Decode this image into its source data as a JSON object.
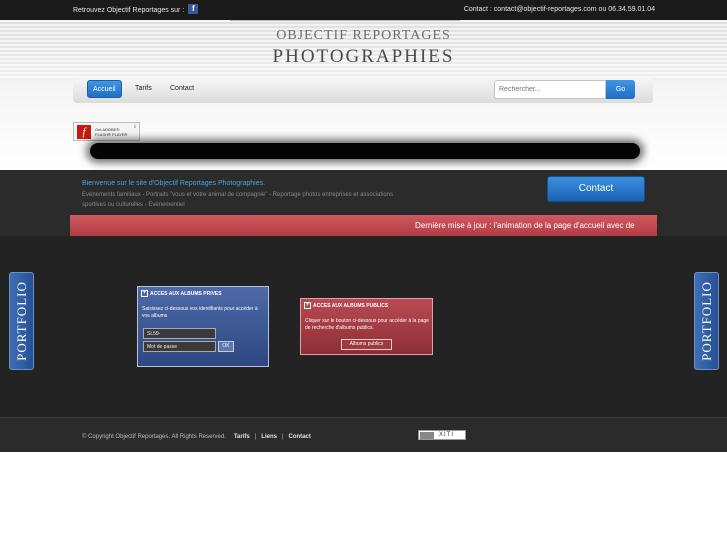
{
  "topbar": {
    "follow_text": "Retrouvez Objectif Reportages sur :",
    "facebook_glyph": "f",
    "contact_line": "Contact : contact@objectif-reportages.com ou 06.34.59.01.04"
  },
  "header": {
    "logo_line1": "OBJECTIF REPORTAGES",
    "logo_line2": "PHOTOGRAPHIES"
  },
  "nav": {
    "items": [
      {
        "label": "Accueil",
        "active": true
      },
      {
        "label": "Tarifs",
        "active": false
      },
      {
        "label": "Contact",
        "active": false
      }
    ]
  },
  "search": {
    "placeholder": "Rechercher...",
    "button_label": "Go"
  },
  "flash": {
    "line1": "Get ADOBE®",
    "line2": "FLASH® PLAYER",
    "logo_glyph": "f"
  },
  "info": {
    "welcome": "Bienvenue sur le site d'Objectif Reportages Photographies.",
    "description": "Evénements familiaux - Portraits \"vous et votre animal de compagnie\" - Reportage photos entreprises et associations sportives ou culturelles - Evènementiel",
    "contact_button": "Contact",
    "marquee": "Dernière mise à jour : l'animation de la page d'accueil avec de"
  },
  "portfolio": {
    "label_left": "PORTFOLIO",
    "label_right": "PORTFOLIO"
  },
  "private_albums": {
    "title": "ACCES AUX ALBUMS PRIVES",
    "instructions": "Saisissez ci-dessous vos identifiants pour accéder à vos albums",
    "username_value": "SL59-",
    "password_value": "Mot de passe",
    "ok_label": "OK"
  },
  "public_albums": {
    "title": "ACCES AUX ALBUMS PUBLICS",
    "instructions": "Cliquer sur le bouton ci-dessous pour accéder à la page de recherche d'albums publics.",
    "button_label": "Albums publics"
  },
  "footer": {
    "copyright": "© Copyright Objectif Reportages. All Rights Reserved.",
    "links": [
      "Tarifs",
      "Liens",
      "Contact"
    ],
    "separator": "|",
    "xiti_label": "XITI"
  },
  "colors": {
    "accent_blue": "#2a7fd6",
    "marquee_red": "#b13c44",
    "dark_bg": "#232323"
  }
}
